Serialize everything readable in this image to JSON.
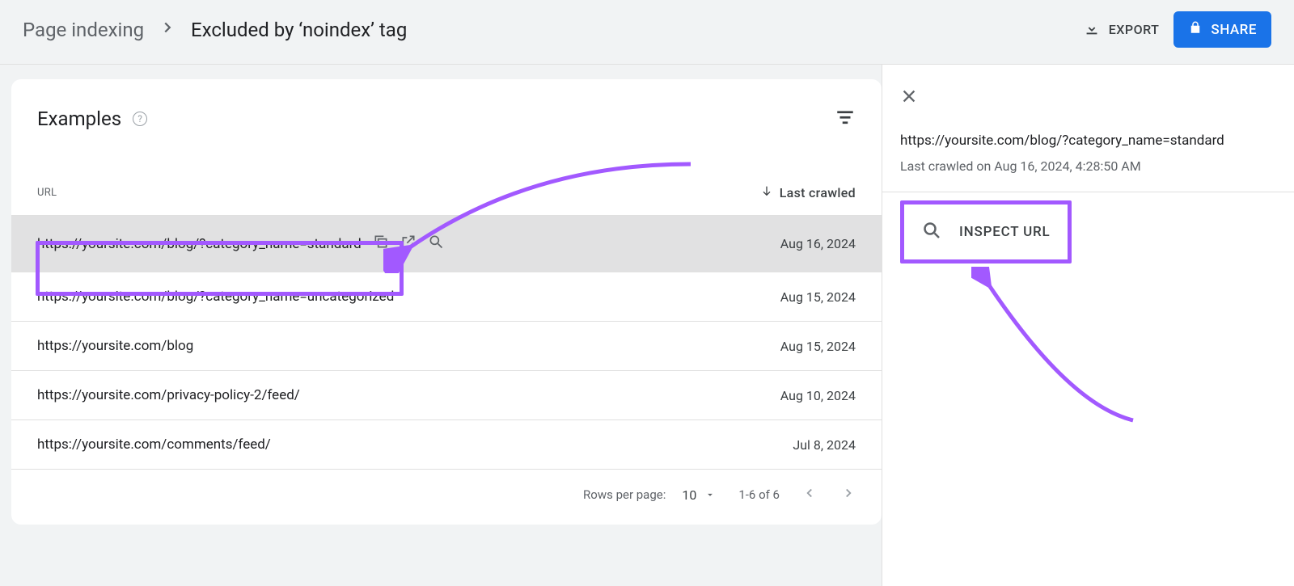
{
  "header": {
    "breadcrumb_parent": "Page indexing",
    "breadcrumb_current": "Excluded by ‘noindex’ tag",
    "export_label": "EXPORT",
    "share_label": "SHARE"
  },
  "card": {
    "title": "Examples",
    "columns": {
      "url": "URL",
      "crawled": "Last crawled"
    },
    "rows": [
      {
        "url": "https://yoursite.com/blog/?category_name=standard",
        "date": "Aug 16, 2024",
        "selected": true
      },
      {
        "url": "https://yoursite.com/blog/?category_name=uncategorized",
        "date": "Aug 15, 2024",
        "selected": false
      },
      {
        "url": "https://yoursite.com/blog",
        "date": "Aug 15, 2024",
        "selected": false
      },
      {
        "url": "https://yoursite.com/privacy-policy-2/feed/",
        "date": "Aug 10, 2024",
        "selected": false
      },
      {
        "url": "https://yoursite.com/comments/feed/",
        "date": "Jul 8, 2024",
        "selected": false
      }
    ],
    "pagination": {
      "rows_per_page_label": "Rows per page:",
      "rows_per_page": "10",
      "range": "1-6 of 6"
    }
  },
  "detail": {
    "url": "https://yoursite.com/blog/?category_name=standard",
    "crawled": "Last crawled on Aug 16, 2024, 4:28:50 AM",
    "inspect_label": "INSPECT URL"
  }
}
